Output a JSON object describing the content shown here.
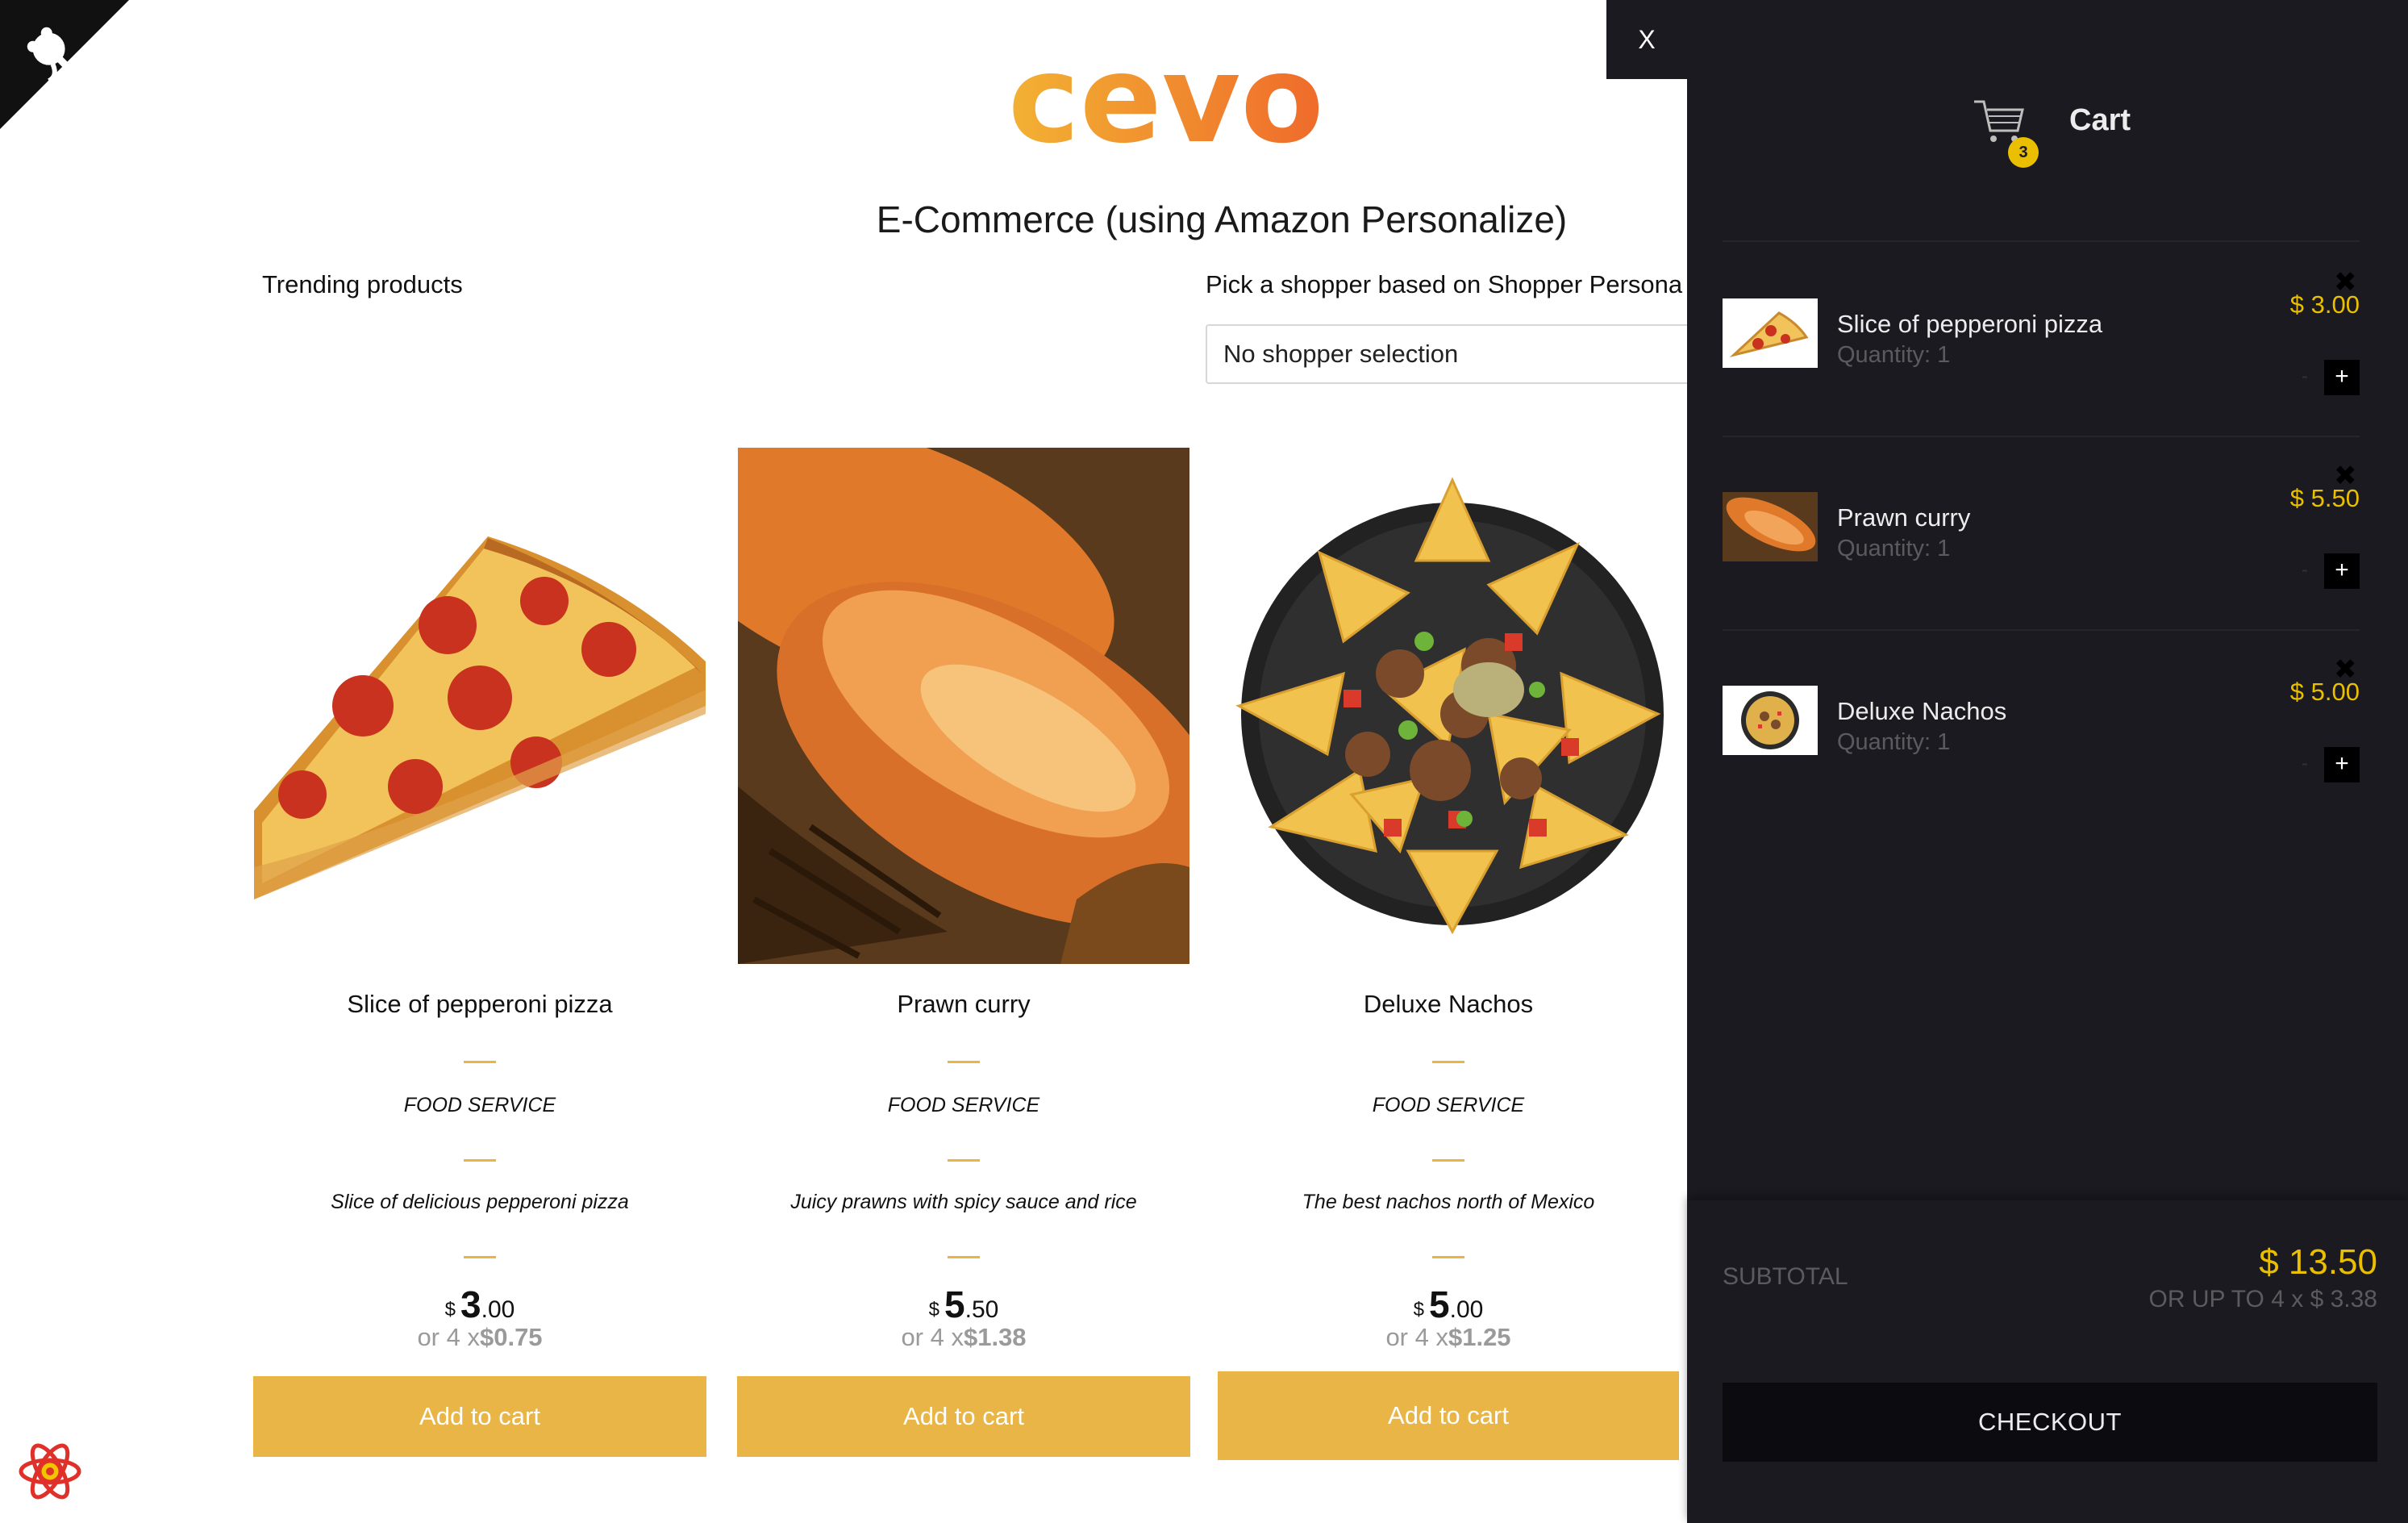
{
  "header": {
    "logo_text": "cevo",
    "app_title": "E-Commerce (using Amazon Personalize)"
  },
  "trending": {
    "label": "Trending products"
  },
  "shopper": {
    "label": "Pick a shopper based on Shopper Persona",
    "selected": "No shopper selection"
  },
  "products": [
    {
      "name": "Slice of pepperoni pizza",
      "category": "FOOD SERVICE",
      "description": "Slice of delicious pepperoni pizza",
      "currency": "$",
      "price_whole": "3",
      "price_cents": ".00",
      "installment_prefix": "or 4 x",
      "installment_value": "$0.75",
      "button": "Add to cart"
    },
    {
      "name": "Prawn curry",
      "category": "FOOD SERVICE",
      "description": "Juicy prawns with spicy sauce and rice",
      "currency": "$",
      "price_whole": "5",
      "price_cents": ".50",
      "installment_prefix": "or 4 x",
      "installment_value": "$1.38",
      "button": "Add to cart"
    },
    {
      "name": "Deluxe Nachos",
      "category": "FOOD SERVICE",
      "description": "The best nachos north of Mexico",
      "currency": "$",
      "price_whole": "5",
      "price_cents": ".00",
      "installment_prefix": "or 4 x",
      "installment_value": "$1.25",
      "button": "Add to cart"
    }
  ],
  "cart": {
    "close": "X",
    "title": "Cart",
    "badge_count": "3",
    "items": [
      {
        "title": "Slice of pepperoni pizza",
        "quantity": "Quantity: 1",
        "price": "$ 3.00",
        "remove": "✖",
        "minus": "-",
        "plus": "+"
      },
      {
        "title": "Prawn curry",
        "quantity": "Quantity: 1",
        "price": "$ 5.50",
        "remove": "✖",
        "minus": "-",
        "plus": "+"
      },
      {
        "title": "Deluxe Nachos",
        "quantity": "Quantity: 1",
        "price": "$ 5.00",
        "remove": "✖",
        "minus": "-",
        "plus": "+"
      }
    ],
    "subtotal_label": "SUBTOTAL",
    "subtotal_value": "$ 13.50",
    "subtotal_installment": "OR UP TO 4 x $ 3.38",
    "checkout": "CHECKOUT"
  },
  "colors": {
    "accent": "#e8b546",
    "cart_bg": "#1b1a20",
    "price_yellow": "#eabf00"
  },
  "icons": {
    "corner": "github-octocat-icon",
    "cart": "shopping-cart-icon",
    "react": "react-atom-icon"
  }
}
